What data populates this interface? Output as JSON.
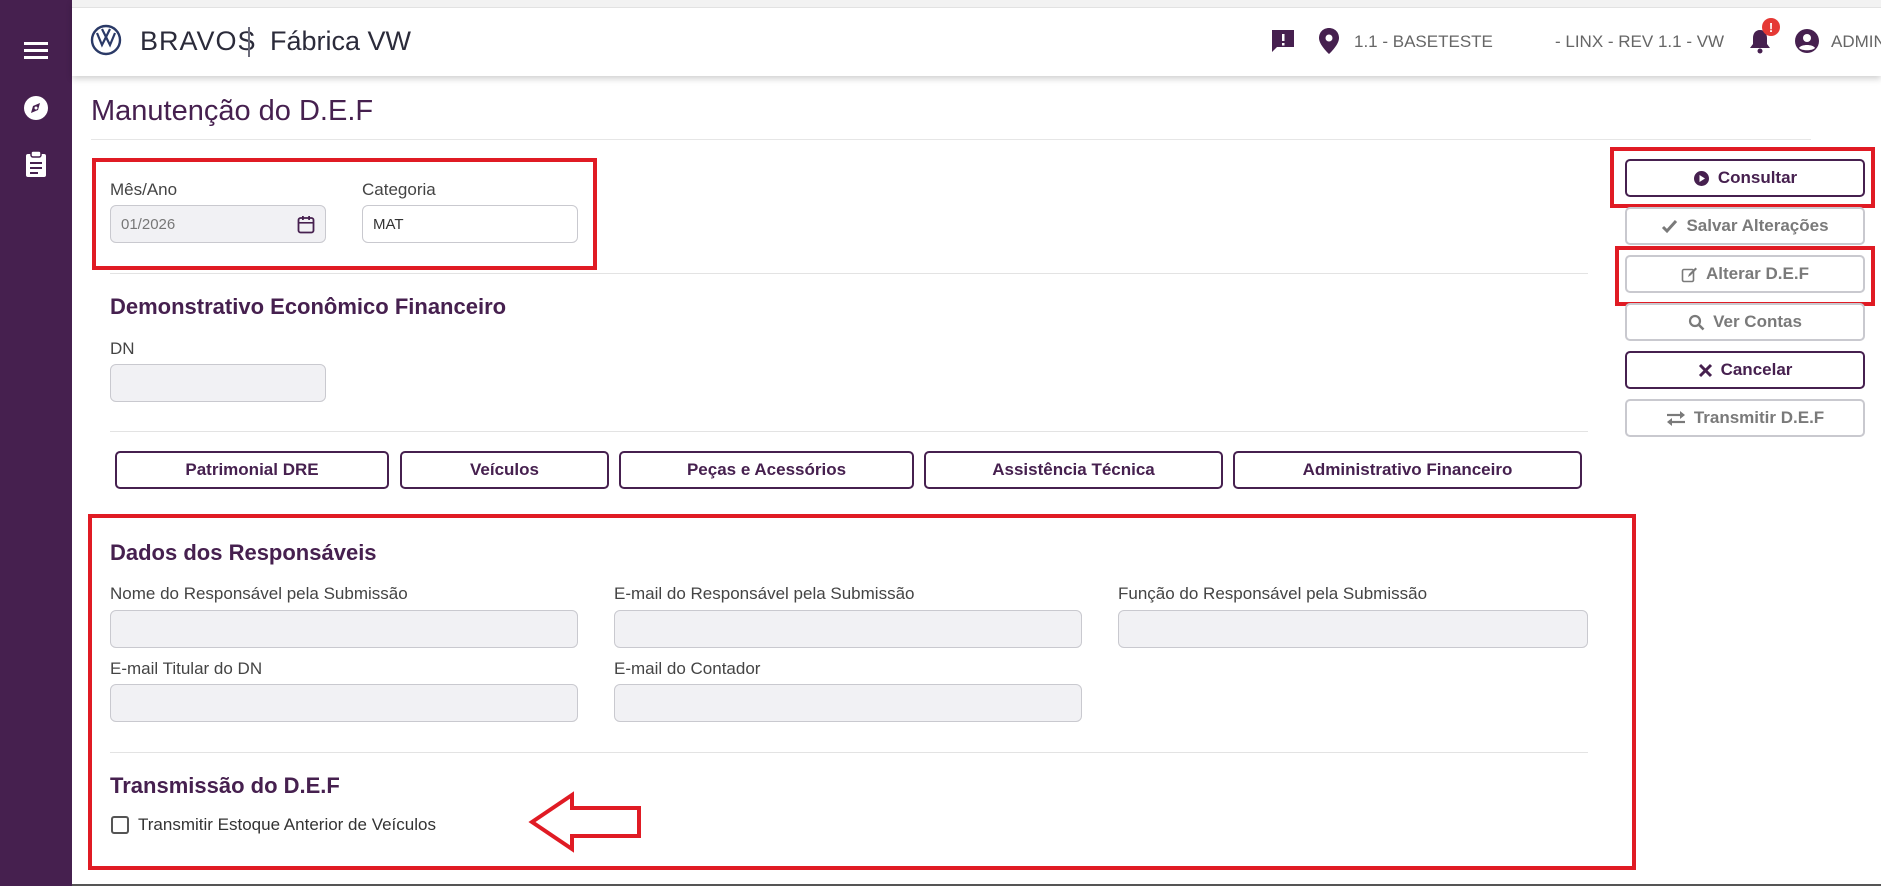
{
  "header": {
    "brand": "BRAVOS",
    "factory": "Fábrica VW",
    "location": "1.1 - BASETESTE",
    "org": "- LINX - REV 1.1 - VW",
    "notification_badge": "!",
    "user": "ADMIN"
  },
  "page": {
    "title": "Manutenção do D.E.F"
  },
  "filters": {
    "month_label": "Mês/Ano",
    "month_value": "01/2026",
    "category_label": "Categoria",
    "category_value": "MAT"
  },
  "def_section": {
    "title": "Demonstrativo Econômico Financeiro",
    "dn_label": "DN",
    "dn_value": ""
  },
  "tabs": [
    {
      "label": "Patrimonial DRE"
    },
    {
      "label": "Veículos"
    },
    {
      "label": "Peças e Acessórios"
    },
    {
      "label": "Assistência Técnica"
    },
    {
      "label": "Administrativo Financeiro"
    }
  ],
  "responsaveis": {
    "title": "Dados dos Responsáveis",
    "nome_label": "Nome do Responsável pela Submissão",
    "email_label": "E-mail do Responsável pela Submissão",
    "funcao_label": "Função do Responsável pela Submissão",
    "titular_label": "E-mail Titular do DN",
    "contador_label": "E-mail do Contador",
    "nome_value": "",
    "email_value": "",
    "funcao_value": "",
    "titular_value": "",
    "contador_value": ""
  },
  "transmissao": {
    "title": "Transmissão do D.E.F",
    "checkbox_label": "Transmitir Estoque Anterior de Veículos",
    "checked": false
  },
  "actions": {
    "consultar": "Consultar",
    "salvar": "Salvar Alterações",
    "alterar": "Alterar D.E.F",
    "ver_contas": "Ver Contas",
    "cancelar": "Cancelar",
    "transmitir": "Transmitir D.E.F"
  },
  "colors": {
    "brand": "#46204f",
    "highlight": "#e01b24",
    "alert": "#e53935"
  }
}
